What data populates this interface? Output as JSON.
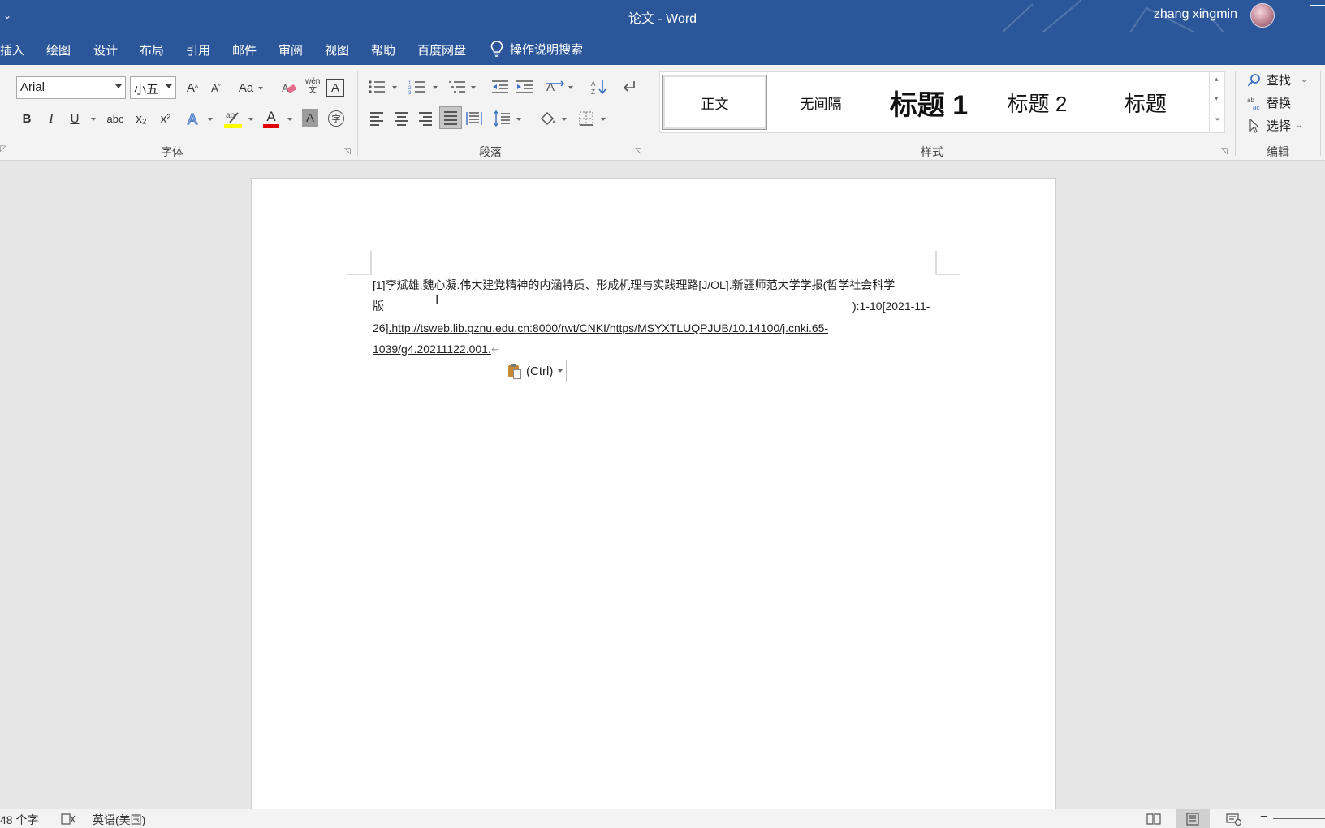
{
  "window": {
    "title": "论文  -  Word",
    "user_name": "zhang xingmin",
    "quick_access": "⌄"
  },
  "tabs": [
    "插入",
    "绘图",
    "设计",
    "布局",
    "引用",
    "邮件",
    "审阅",
    "视图",
    "帮助",
    "百度网盘"
  ],
  "tell_me": "操作说明搜索",
  "font_group": {
    "label": "字体",
    "font_name": "Arial",
    "font_size": "小五",
    "grow": "A",
    "shrink": "A",
    "change_case": "Aa",
    "bold": "B",
    "italic": "I",
    "underline": "U",
    "strike": "abc",
    "subscript": "x₂",
    "superscript": "x²",
    "phonetic": "wén 文",
    "char_border": "A",
    "font_color_letter": "A",
    "shading_letter": "A",
    "enclose": "字"
  },
  "paragraph_group": {
    "label": "段落"
  },
  "styles_group": {
    "label": "样式",
    "items": [
      "正文",
      "无间隔",
      "标题 1",
      "标题 2",
      "标题"
    ]
  },
  "editing_group": {
    "label": "编辑",
    "find": "查找",
    "replace": "替换",
    "select": "选择"
  },
  "document": {
    "line1": "[1]李斌雄,魏心凝.伟大建党精神的内涵特质、形成机理与实践理路[J/OL].新疆师范大学学报(哲学社会科学",
    "line2_left": "版",
    "line2_right": "):1-10[2021-11-",
    "line3_prefix": "26]",
    "line3_url": ".http://tsweb.lib.gznu.edu.cn:8000/rwt/CNKI/https/MSYXTLUQPJUB/10.14100/j.cnki.65-",
    "line4_url": "1039/g4.20211122.001.",
    "paragraph_mark": "↵",
    "paste_options_label": "(Ctrl)"
  },
  "statusbar": {
    "word_count": "48 个字",
    "language": "英语(美国)"
  },
  "colors": {
    "title_bar": "#2b579a",
    "ribbon_bg": "#f3f3f3",
    "highlight": "#ffff00",
    "font_color": "#e00000"
  }
}
